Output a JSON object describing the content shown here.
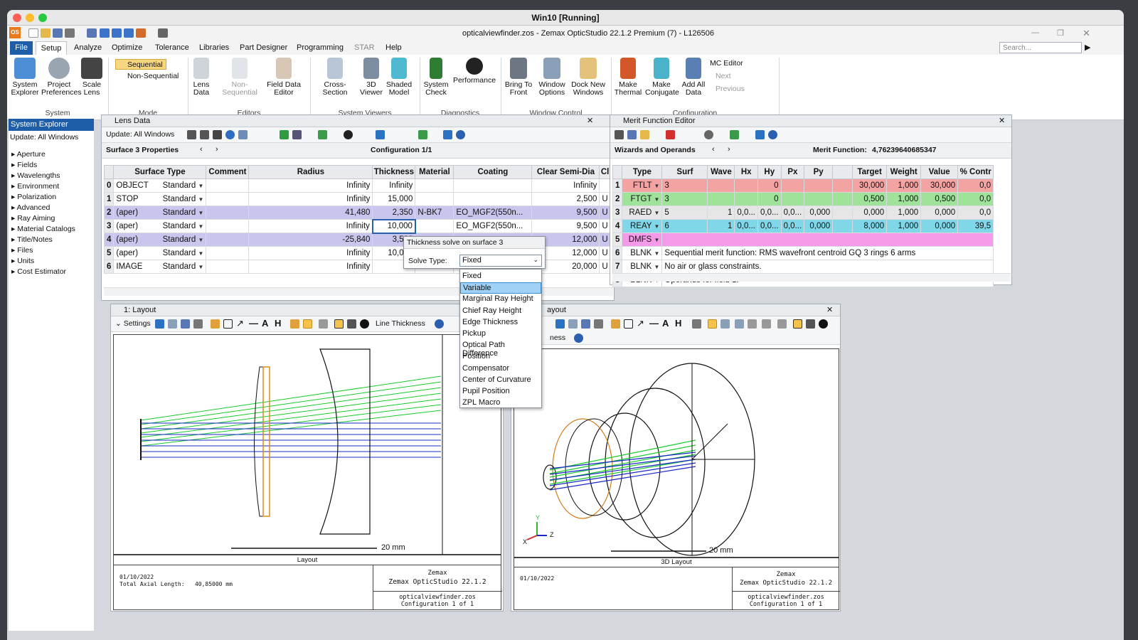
{
  "vm_title": "Win10 [Running]",
  "app_title": "opticalviewfinder.zos - Zemax OpticStudio 22.1.2   Premium (7) - L126506",
  "app_logo": "OS",
  "search_placeholder": "Search...",
  "ribbon_tabs": [
    "File",
    "Setup",
    "Analyze",
    "Optimize",
    "Tolerance",
    "Libraries",
    "Part Designer",
    "Programming",
    "STAR",
    "Help"
  ],
  "ribbon": {
    "system_explorer": "System\nExplorer",
    "project_preferences": "Project\nPreferences",
    "scale_lens": "Scale\nLens",
    "sequential": "Sequential",
    "non_sequential_mode": "Non-Sequential",
    "lens_data": "Lens\nData",
    "non_sequential": "Non-Sequential",
    "field_data_editor": "Field Data\nEditor",
    "cross_section": "Cross-Section",
    "viewer_3d": "3D\nViewer",
    "shaded_model": "Shaded\nModel",
    "system_check": "System\nCheck",
    "performance": "Performance",
    "bring_to_front": "Bring To\nFront",
    "window_options": "Window\nOptions",
    "dock_new_windows": "Dock New\nWindows",
    "make_thermal": "Make\nThermal",
    "make_conjugate": "Make\nConjugate",
    "add_all_data": "Add All\nData",
    "mc_editor": "MC Editor",
    "next": "Next",
    "previous": "Previous",
    "groups": [
      "System",
      "Mode",
      "Editors",
      "System Viewers",
      "Diagnostics",
      "Window Control",
      "Configuration"
    ]
  },
  "system_explorer": {
    "title": "System Explorer",
    "update": "Update: All Windows",
    "items": [
      "Aperture",
      "Fields",
      "Wavelengths",
      "Environment",
      "Polarization",
      "Advanced",
      "Ray Aiming",
      "Material Catalogs",
      "Title/Notes",
      "Files",
      "Units",
      "Cost Estimator"
    ]
  },
  "lens_data": {
    "title": "Lens Data",
    "update": "Update: All Windows",
    "surface_label": "Surface  3 Properties",
    "configuration": "Configuration 1/1",
    "columns": [
      "Surface Type",
      "Comment",
      "Radius",
      "Thickness",
      "Material",
      "Coating",
      "Clear Semi-Dia",
      "Cl"
    ],
    "rows": [
      {
        "n": "0",
        "type": "OBJECT",
        "surf": "Standard",
        "radius": "Infinity",
        "thickness": "Infinity",
        "material": "",
        "coating": "",
        "semi": "Infinity",
        "u": ""
      },
      {
        "n": "1",
        "type": "STOP",
        "surf": "Standard",
        "radius": "Infinity",
        "thickness": "15,000",
        "material": "",
        "coating": "",
        "semi": "2,500",
        "u": "U"
      },
      {
        "n": "2",
        "type": "(aper)",
        "surf": "Standard",
        "radius": "41,480",
        "thickness": "2,350",
        "material": "N-BK7",
        "coating": "EO_MGF2(550n...",
        "semi": "9,500",
        "u": "U"
      },
      {
        "n": "3",
        "type": "(aper)",
        "surf": "Standard",
        "radius": "Infinity",
        "thickness": "10,000",
        "material": "",
        "coating": "EO_MGF2(550n...",
        "semi": "9,500",
        "u": "U"
      },
      {
        "n": "4",
        "type": "(aper)",
        "surf": "Standard",
        "radius": "-25,840",
        "thickness": "3,500",
        "material": "",
        "coating": "",
        "semi": "12,000",
        "u": "U"
      },
      {
        "n": "5",
        "type": "(aper)",
        "surf": "Standard",
        "radius": "Infinity",
        "thickness": "10,000",
        "material": "",
        "coating": "",
        "semi": "12,000",
        "u": "U"
      },
      {
        "n": "6",
        "type": "IMAGE",
        "surf": "Standard",
        "radius": "Infinity",
        "thickness": "-",
        "material": "",
        "coating": "",
        "semi": "20,000",
        "u": "U"
      }
    ]
  },
  "solve_popup": {
    "title": "Thickness solve on surface 3",
    "label": "Solve Type:",
    "value": "Fixed",
    "options": [
      "Fixed",
      "Variable",
      "Marginal Ray Height",
      "Chief Ray Height",
      "Edge Thickness",
      "Pickup",
      "Optical Path Difference",
      "Position",
      "Compensator",
      "Center of Curvature",
      "Pupil Position",
      "ZPL Macro"
    ]
  },
  "merit": {
    "title": "Merit Function Editor",
    "wizards": "Wizards and Operands",
    "mf_label": "Merit Function:",
    "mf_value": "4,76239640685347",
    "columns": [
      "Type",
      "Surf",
      "Wave",
      "Hx",
      "Hy",
      "Px",
      "Py",
      "",
      "Target",
      "Weight",
      "Value",
      "% Contr"
    ],
    "rows": [
      {
        "n": "1",
        "type": "FTLT",
        "surf": "3",
        "wave": "",
        "hx": "",
        "hy": "0",
        "px": "",
        "py": "",
        "target": "30,000",
        "weight": "1,000",
        "value": "30,000",
        "contr": "0,0",
        "color": "#f4a3a3"
      },
      {
        "n": "2",
        "type": "FTGT",
        "surf": "3",
        "wave": "",
        "hx": "",
        "hy": "0",
        "px": "",
        "py": "",
        "target": "0,500",
        "weight": "1,000",
        "value": "0,500",
        "contr": "0,0",
        "color": "#9fe29a"
      },
      {
        "n": "3",
        "type": "RAED",
        "surf": "5",
        "wave": "1",
        "hx": "0,0...",
        "hy": "0,0...",
        "px": "0,0...",
        "py": "0,000",
        "target": "0,000",
        "weight": "1,000",
        "value": "0,000",
        "contr": "0,0",
        "color": "#e6e6e6"
      },
      {
        "n": "4",
        "type": "REAY",
        "surf": "6",
        "wave": "1",
        "hx": "0,0...",
        "hy": "0,0...",
        "px": "0,0...",
        "py": "0,000",
        "target": "8,000",
        "weight": "1,000",
        "value": "0,000",
        "contr": "39,5",
        "color": "#7fd7e8"
      },
      {
        "n": "5",
        "type": "DMFS",
        "text": "",
        "color": "#f59ae8"
      },
      {
        "n": "6",
        "type": "BLNK",
        "text": "Sequential merit function: RMS wavefront centroid GQ 3 rings 6 arms",
        "color": "#fff"
      },
      {
        "n": "7",
        "type": "BLNK",
        "text": "No air or glass constraints.",
        "color": "#fff"
      },
      {
        "n": "8",
        "type": "BLNK",
        "text": "Operands for field 1.",
        "color": "#fff"
      }
    ]
  },
  "layout1": {
    "title": "1: Layout",
    "settings": "Settings",
    "line_thickness": "Line Thickness",
    "scale": "20 mm",
    "caption": "Layout",
    "date": "01/10/2022",
    "axial": "Total Axial Length:   40,85000 mm",
    "company": "Zemax",
    "product": "Zemax OpticStudio 22.1.2",
    "file": "opticalviewfinder.zos",
    "config": "Configuration 1 of 1"
  },
  "layout3d": {
    "title": "ayout",
    "settings": "ness",
    "scale": "20 mm",
    "caption": "3D Layout",
    "date": "01/10/2022",
    "company": "Zemax",
    "product": "Zemax OpticStudio 22.1.2",
    "file": "opticalviewfinder.zos",
    "config": "Configuration 1 of 1",
    "axis_x": "X",
    "axis_y": "Y",
    "axis_z": "Z"
  }
}
